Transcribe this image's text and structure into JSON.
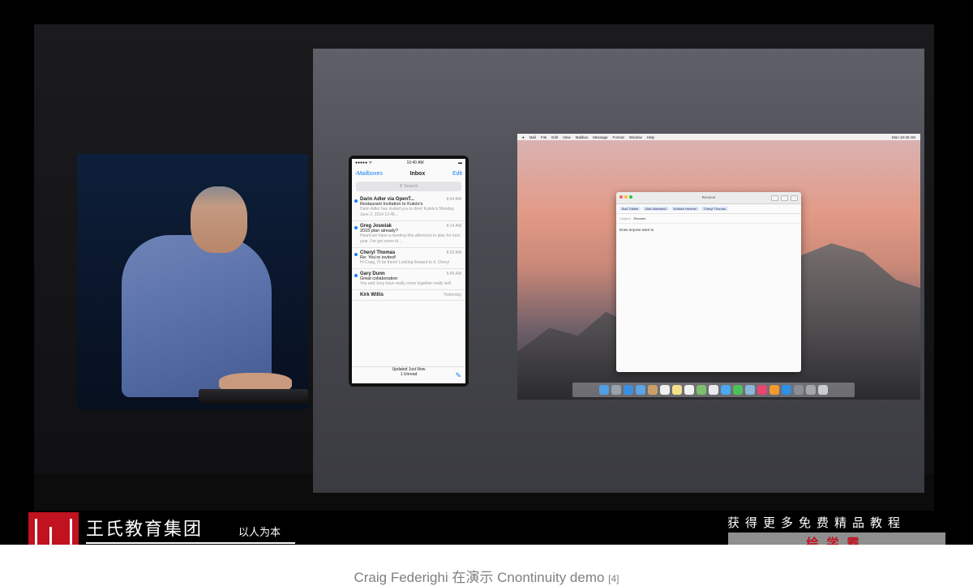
{
  "iphone": {
    "status_left": "●●●●● ᯤ",
    "status_time": "10:40 AM",
    "back": "Mailboxes",
    "title": "Inbox",
    "edit": "Edit",
    "search_placeholder": "Search",
    "messages": [
      {
        "from": "Darin Adler via OpenT...",
        "time": "8:44 AM",
        "subject": "Restaurant Invitation to Kuleto's",
        "preview": "Darin Adler has invited you to dine! Kuleto's Monday, June 2, 2014 12:45..."
      },
      {
        "from": "Greg Joswiak",
        "time": "8:14 AM",
        "subject": "2015 plan already?",
        "preview": "Heard we have a meeting this afternoon to plan for next year. I've got some id..."
      },
      {
        "from": "Cheryl Thomas",
        "time": "8:03 AM",
        "subject": "Re: You're invited!",
        "preview": "Hi Craig, I'll be there! Looking forward to it. Cheryl"
      },
      {
        "from": "Gary Dunn",
        "time": "5:45 AM",
        "subject": "Great collaboration",
        "preview": "You and Jony have really come together really well"
      },
      {
        "from": "Kirk Willis",
        "time": "Yesterday",
        "subject": "",
        "preview": ""
      }
    ],
    "footer_status": "Updated Just Now",
    "footer_unread": "1 Unread"
  },
  "mac": {
    "menu": [
      "Mail",
      "File",
      "Edit",
      "View",
      "Mailbox",
      "Message",
      "Format",
      "Window",
      "Help"
    ],
    "menu_right": "Mon 10:40 AM",
    "mail_title": "Resume",
    "recipients": [
      "Bud Tribble",
      "Bob Mansfield",
      "Kristian Hershel",
      "Cheryl Thomas"
    ],
    "subject_label": "Subject:",
    "subject": "Resume",
    "body": "Does anyone want to"
  },
  "overlay": {
    "brand": "王氏教育集团",
    "brand_sub": "以人为本",
    "promo": "获得更多免费精品教程",
    "promo_bar": "绘学霸"
  },
  "caption": {
    "text": "Craig Federighi 在演示 Cnontinuity demo ",
    "ref": "[4]"
  },
  "colors": {
    "logo_red": "#c1121f",
    "ios_blue": "#1a7ff2"
  }
}
